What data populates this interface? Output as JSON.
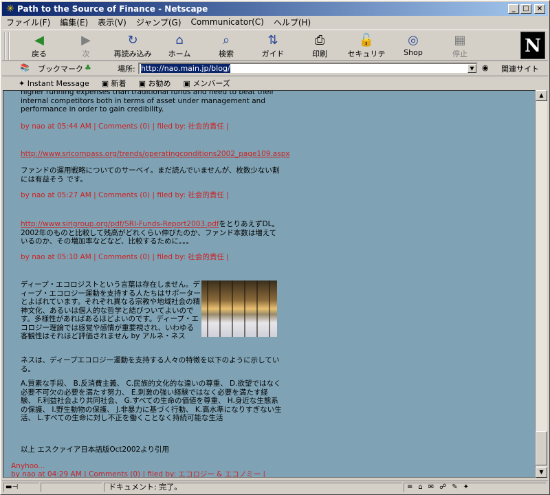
{
  "window": {
    "title": "Path to the Source of Finance - Netscape"
  },
  "menu": [
    "ファイル(F)",
    "編集(E)",
    "表示(V)",
    "ジャンプ(G)",
    "Communicator(C)",
    "ヘルプ(H)"
  ],
  "toolbar": {
    "back": "戻る",
    "forward": "次",
    "reload": "再読み込み",
    "home": "ホーム",
    "search": "検索",
    "guide": "ガイド",
    "print": "印刷",
    "security": "セキュリティ",
    "shop": "Shop",
    "stop": "停止",
    "logo": "N"
  },
  "location": {
    "bookmarks": "ブックマーク",
    "label": "場所:",
    "url": "http://nao.main.jp/blog/",
    "related": "関連サイト"
  },
  "personal": {
    "im": "Instant Message",
    "new": "新着",
    "recommend": "お勧め",
    "members": "メンバーズ"
  },
  "content": {
    "intro": "higher running expenses than traditional funds and need to beat their internal competitors both in terms of asset under management and performance in order to gain credibility.",
    "meta1": "by nao at 05:44 AM | Comments (0) | filed by: 社会的責任 |",
    "url2": "http://www.sricompass.org/trends/operatingconditions2002_page109.aspx",
    "text2": "ファンドの運用戦略についてのサーベイ。まだ読んでいませんが、枚数少ない割には有益そう です。",
    "meta2": "by nao at 05:27 AM | Comments (0) | filed by: 社会的責任 |",
    "url3": "http://www.sirigroup.org/pdf/SRI-Funds-Report2003.pdf",
    "text3": "をとりあえずDL。2002年のものと比較して残高がどれくらい伸びたのか、ファンド本数は増えているのか、その増加率などなど、比較するために。。。",
    "meta3": "by nao at 05:10 AM | Comments (0) | filed by: 社会的責任 |",
    "text4a": "ディープ・エコロジストという言葉は存在しません。ディープ・エコロジー運動を支持する人たちはサポーターとよばれています。それぞれ異なる宗教や地域社会の精神文化、あるいは個人的な哲学と結びついてよいのです。多様性があればあるほどよいのです。ディープ・エコロジー理論では感覚や感情が重要視され、いわゆる客観性はそれほど評価されません by アルネ・ネス",
    "text4b": "ネスは、ディープエコロジー運動を支持する人々の特徴を以下のように示している。",
    "text4c": "A.質素な手段、 B.反消費主義、 C.民族的文化的な違いの尊重、 D.欲望ではなく必要不可欠の必要を満たす努力、 E.刺激の強い経験ではなく必要を満たす経験、 F.利益社会より共同社会、 G.すべての生命の価値を尊重、 H.身近な生態系の保護、 I.野生動物の保護、 J.非暴力に基づく行動、 K.高水準になりすぎない生活、 L.すべての生命に対し不正を働くことなく持続可能な生活",
    "text4d": "以上 エスクァイア日本語版Oct2002より引用",
    "anyhoo": "Anyhoo...",
    "meta4": "by nao at 04:29 AM | Comments (0) | filed by: エコロジー & エコノミー |"
  },
  "status": {
    "text": "ドキュメント: 完了。"
  }
}
